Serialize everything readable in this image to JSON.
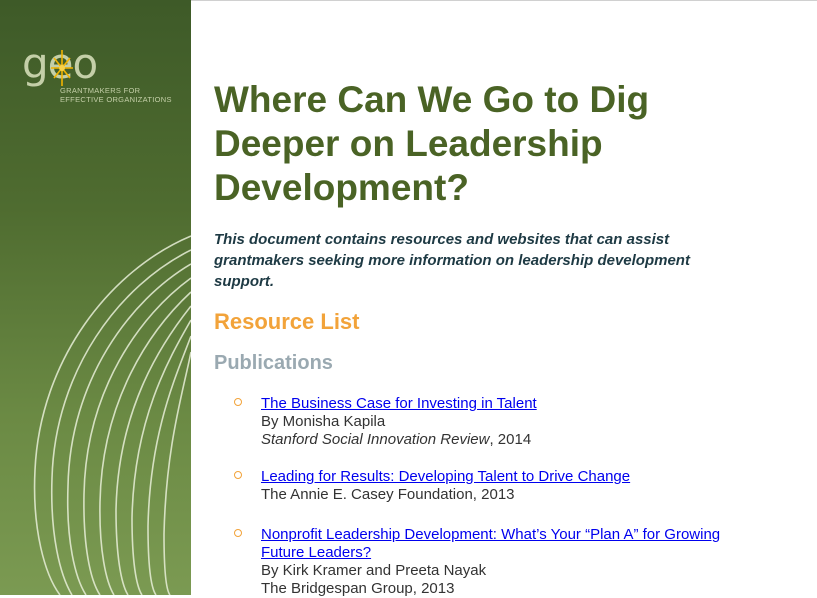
{
  "logo": {
    "wordmark": "geo",
    "tagline": "GRANTMAKERS FOR\nEFFECTIVE ORGANIZATIONS"
  },
  "document": {
    "title": "Where Can We Go to Dig Deeper on Leadership Development?",
    "intro": "This document contains resources and websites that can assist grantmakers seeking more information on leadership development support.",
    "section_heading": "Resource List",
    "subsection_heading": "Publications",
    "publications": [
      {
        "link": "The Business Case for Investing in Talent",
        "author": "By Monisha Kapila",
        "source": "Stanford Social Innovation Review",
        "source_suffix": ", 2014"
      },
      {
        "link": "Leading for Results: Developing Talent to Drive Change",
        "source_plain": "The Annie E. Casey Foundation, 2013"
      },
      {
        "link": "Nonprofit Leadership Development: What’s Your “Plan A” for Growing Future Leaders?",
        "author": "By Kirk Kramer and Preeta Nayak",
        "source_plain": "The Bridgespan Group, 2013"
      }
    ]
  },
  "colors": {
    "title": "#4a6325",
    "intro": "#1e3a44",
    "section": "#f2a33a",
    "subsection": "#9aa9b1",
    "link": "#0000ee",
    "sidebar": "#4f6c30"
  }
}
